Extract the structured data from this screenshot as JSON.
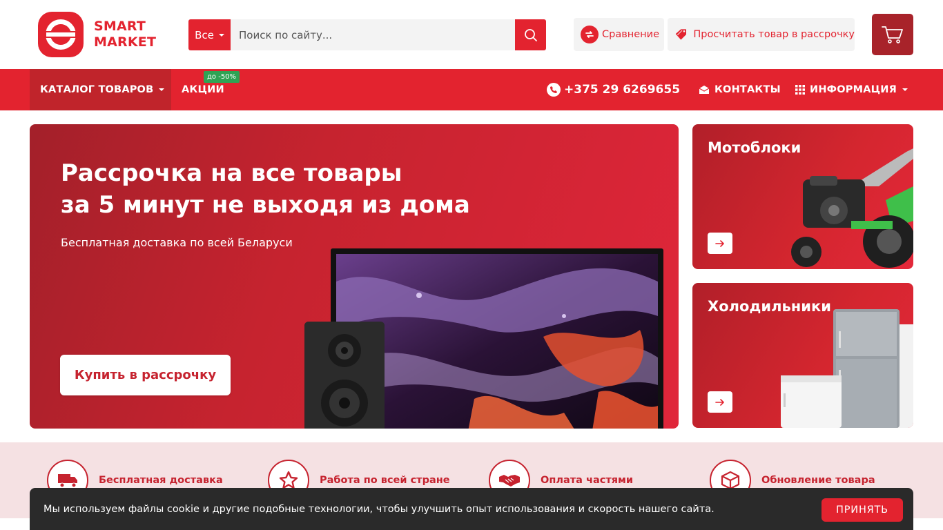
{
  "header": {
    "logo_line1": "SMART",
    "logo_line2": "MARKET",
    "search_category": "Все",
    "search_placeholder": "Поиск по сайту...",
    "compare_label": "Сравнение",
    "installment_label": "Просчитать товар в рассрочку"
  },
  "nav": {
    "catalog_label": "КАТАЛОГ ТОВАРОВ",
    "promo_label": "АКЦИИ",
    "promo_badge": "до -50%",
    "phone": "+375 29 6269655",
    "contacts_label": "КОНТАКТЫ",
    "info_label": "ИНФОРМАЦИЯ"
  },
  "hero": {
    "title_line1": "Рассрочка на все товары",
    "title_line2": "за 5 минут не выходя из дома",
    "subtitle": "Бесплатная доставка по всей Беларуси",
    "cta_label": "Купить в рассрочку"
  },
  "cards": [
    {
      "title": "Мотоблоки"
    },
    {
      "title": "Холодильники"
    }
  ],
  "features": [
    {
      "label": "Бесплатная доставка",
      "icon": "truck-icon"
    },
    {
      "label": "Работа по всей стране",
      "icon": "star-icon"
    },
    {
      "label": "Оплата частями",
      "icon": "handshake-icon"
    },
    {
      "label": "Обновление товара",
      "icon": "box-icon"
    }
  ],
  "cookie": {
    "text": "Мы используем файлы cookie и другие подобные технологии, чтобы улучшить опыт использования и скорость нашего сайта.",
    "accept_label": "ПРИНЯТЬ"
  },
  "colors": {
    "brand_red": "#e3232f",
    "dark_red": "#c0242b",
    "cart_red": "#a8232a",
    "badge_green": "#2fa354",
    "features_bg": "#f5e1e3"
  }
}
